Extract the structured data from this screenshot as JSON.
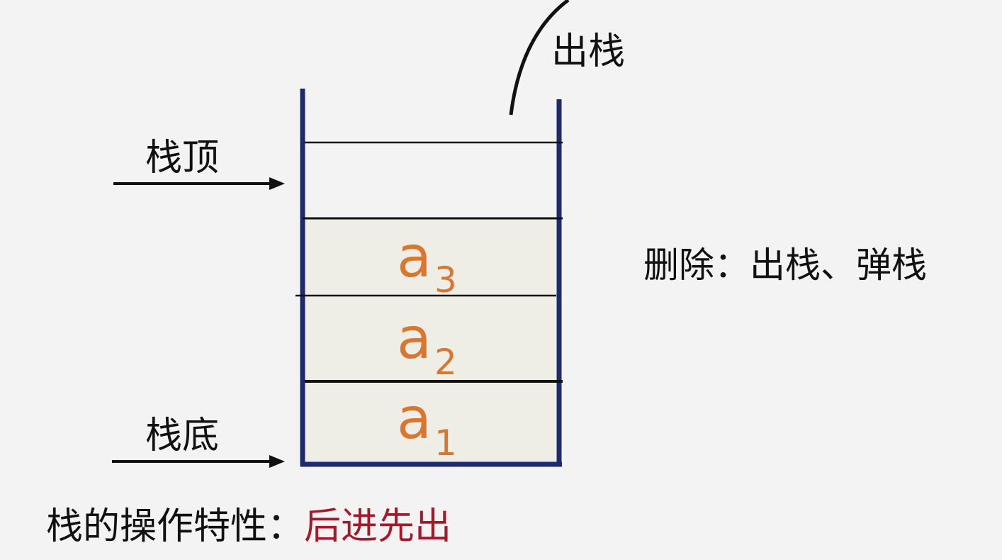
{
  "labels": {
    "pop": "出栈",
    "top": "栈顶",
    "bottom": "栈底",
    "delete": "删除：出栈、弹栈"
  },
  "elements": [
    {
      "base": "a",
      "sub": "3"
    },
    {
      "base": "a",
      "sub": "2"
    },
    {
      "base": "a",
      "sub": "1"
    }
  ],
  "property": {
    "label": "栈的操作特性：",
    "value": "后进先出"
  },
  "colors": {
    "background": "#f3f3f3",
    "stack_wall": "#1d2a6e",
    "element_fill": "#eeede6",
    "element_text": "#d9772f",
    "highlight_text": "#a51a2a"
  }
}
